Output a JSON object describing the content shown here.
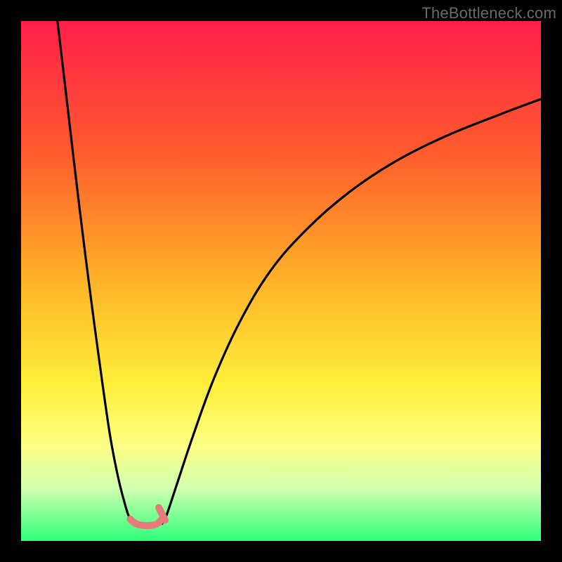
{
  "watermark": "TheBottleneck.com",
  "chart_data": {
    "type": "line",
    "title": "",
    "xlabel": "",
    "ylabel": "",
    "xlim": [
      0,
      100
    ],
    "ylim": [
      0,
      100
    ],
    "grid": false,
    "background_gradient_stops": [
      {
        "pos": 0,
        "color": "#ff1f4b"
      },
      {
        "pos": 25,
        "color": "#ff5a2d"
      },
      {
        "pos": 50,
        "color": "#ffb327"
      },
      {
        "pos": 70,
        "color": "#ffef3a"
      },
      {
        "pos": 82,
        "color": "#fcff86"
      },
      {
        "pos": 90,
        "color": "#cfffb0"
      },
      {
        "pos": 100,
        "color": "#2dff7a"
      }
    ],
    "series": [
      {
        "name": "left-branch",
        "color": "#000000",
        "x": [
          7,
          9,
          11,
          13,
          15,
          17,
          18.5,
          20,
          21,
          22.1
        ],
        "y": [
          100,
          83,
          66,
          50,
          35,
          21,
          13,
          7,
          4.2,
          3.3
        ]
      },
      {
        "name": "right-branch",
        "color": "#000000",
        "x": [
          27.1,
          28,
          30,
          33,
          37,
          42,
          48,
          55,
          63,
          72,
          82,
          92,
          100
        ],
        "y": [
          3.3,
          5,
          11,
          20,
          31,
          42,
          52,
          60,
          67,
          73,
          78,
          82,
          85
        ]
      },
      {
        "name": "valley-marker",
        "color": "#e77a7a",
        "stroke_width": 10,
        "x": [
          21,
          22.1,
          23.5,
          25,
          26.2,
          27.1
        ],
        "y": [
          4.2,
          3.3,
          3,
          3,
          3.3,
          4.2
        ]
      },
      {
        "name": "valley-marker-accent",
        "color": "#e77a7a",
        "stroke_width": 10,
        "x": [
          26.5,
          27.1,
          27.7
        ],
        "y": [
          6.4,
          5.2,
          4.0
        ]
      }
    ]
  }
}
